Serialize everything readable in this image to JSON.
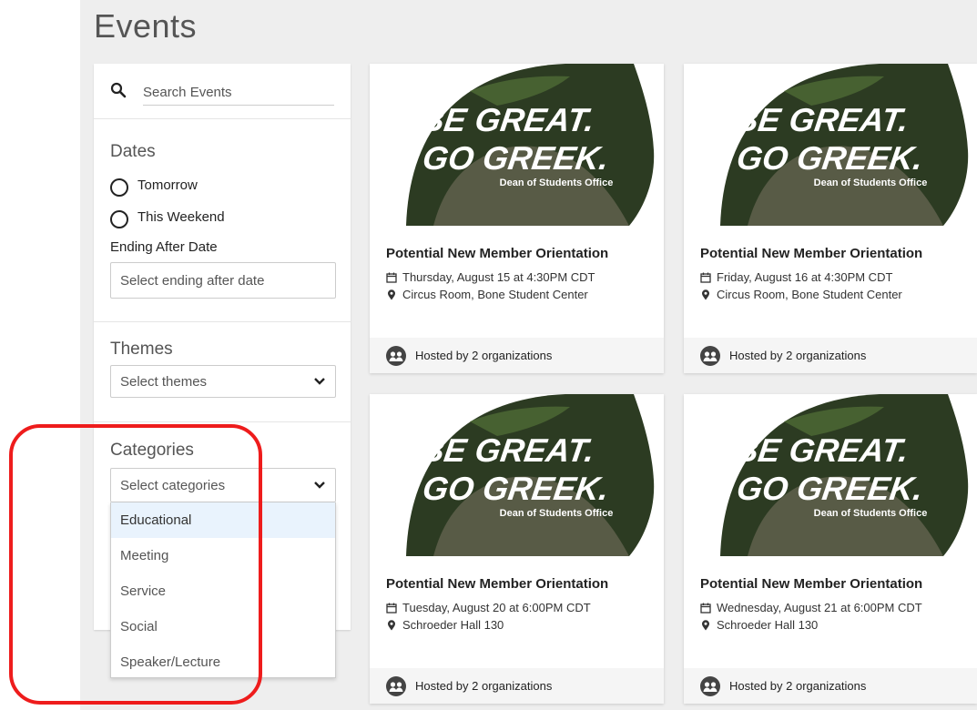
{
  "page": {
    "title": "Events"
  },
  "search": {
    "placeholder": "Search Events"
  },
  "filters": {
    "dates": {
      "title": "Dates",
      "options": [
        {
          "label": "Tomorrow"
        },
        {
          "label": "This Weekend"
        }
      ],
      "ending_after_label": "Ending After Date",
      "ending_after_placeholder": "Select ending after date"
    },
    "themes": {
      "title": "Themes",
      "placeholder": "Select themes"
    },
    "categories": {
      "title": "Categories",
      "placeholder": "Select categories",
      "options": [
        {
          "label": "Educational",
          "highlighted": true
        },
        {
          "label": "Meeting"
        },
        {
          "label": "Service"
        },
        {
          "label": "Social"
        },
        {
          "label": "Speaker/Lecture"
        }
      ]
    }
  },
  "events": [
    {
      "title": "Potential New Member Orientation",
      "date": "Thursday, August 15 at 4:30PM CDT",
      "location": "Circus Room, Bone Student Center",
      "hosted_by": "Hosted by 2 organizations",
      "image": {
        "line1": "BE GREAT.",
        "line2": "GO GREEK.",
        "caption": "Dean of Students Office"
      }
    },
    {
      "title": "Potential New Member Orientation",
      "date": "Friday, August 16 at 4:30PM CDT",
      "location": "Circus Room, Bone Student Center",
      "hosted_by": "Hosted by 2 organizations",
      "image": {
        "line1": "BE GREAT.",
        "line2": "GO GREEK.",
        "caption": "Dean of Students Office"
      }
    },
    {
      "title": "Potential New Member Orientation",
      "date": "Tuesday, August 20 at 6:00PM CDT",
      "location": "Schroeder Hall 130",
      "hosted_by": "Hosted by 2 organizations",
      "image": {
        "line1": "BE GREAT.",
        "line2": "GO GREEK.",
        "caption": "Dean of Students Office"
      }
    },
    {
      "title": "Potential New Member Orientation",
      "date": "Wednesday, August 21 at 6:00PM CDT",
      "location": "Schroeder Hall 130",
      "hosted_by": "Hosted by 2 organizations",
      "image": {
        "line1": "BE GREAT.",
        "line2": "GO GREEK.",
        "caption": "Dean of Students Office"
      }
    }
  ],
  "colors": {
    "annotation_ring": "#ee1c1c",
    "dropdown_highlight": "#e9f3fd",
    "leaf_dark": "#1f2a18",
    "leaf_green": "#3e5a2a"
  }
}
